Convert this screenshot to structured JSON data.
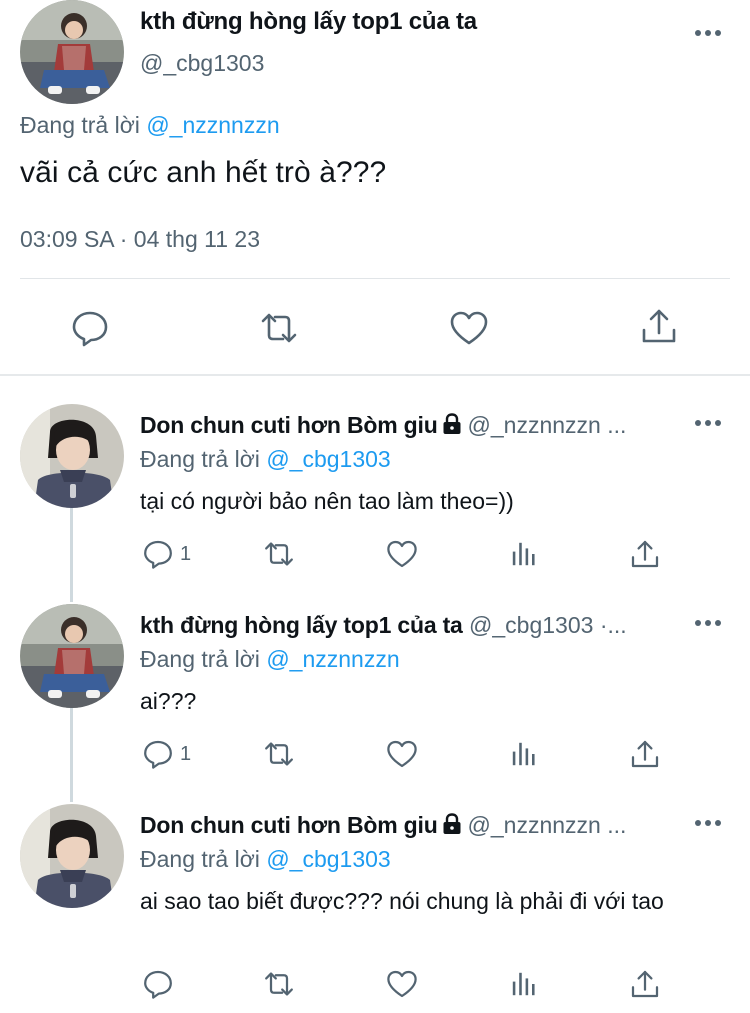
{
  "main_tweet": {
    "display_name": "kth đừng hòng lấy top1 của ta",
    "handle": "@_cbg1303",
    "replying_prefix": "Đang trả lời",
    "replying_to": "@_nzznnzzn",
    "text": "vãi cả cức anh hết trò à???",
    "timestamp": "03:09 SA · 04 thg 11 23",
    "actions": [
      "reply-icon",
      "retweet-icon",
      "like-icon",
      "share-icon"
    ]
  },
  "replies": [
    {
      "display_name": "Don chun cuti hơn Bòm giu",
      "locked": true,
      "handle": "@_nzznnzzn ...",
      "replying_prefix": "Đang trả lời",
      "replying_to": "@_cbg1303",
      "text": "tại có người bảo nên tao làm theo=))",
      "reply_count": "1"
    },
    {
      "display_name": "kth đừng hòng lấy top1 của ta",
      "locked": false,
      "handle": "@_cbg1303 ·...",
      "replying_prefix": "Đang trả lời",
      "replying_to": "@_nzznnzzn",
      "text": "ai???",
      "reply_count": "1"
    },
    {
      "display_name": "Don chun cuti hơn Bòm giu",
      "locked": true,
      "handle": "@_nzznnzzn ...",
      "replying_prefix": "Đang trả lời",
      "replying_to": "@_cbg1303",
      "text": "ai sao tao biết được??? nói chung là phải đi với tao",
      "reply_count": ""
    }
  ],
  "colors": {
    "link": "#1d9bf0",
    "secondary_text": "#536471",
    "primary_text": "#0f1419",
    "divider": "#e1e5e8"
  }
}
